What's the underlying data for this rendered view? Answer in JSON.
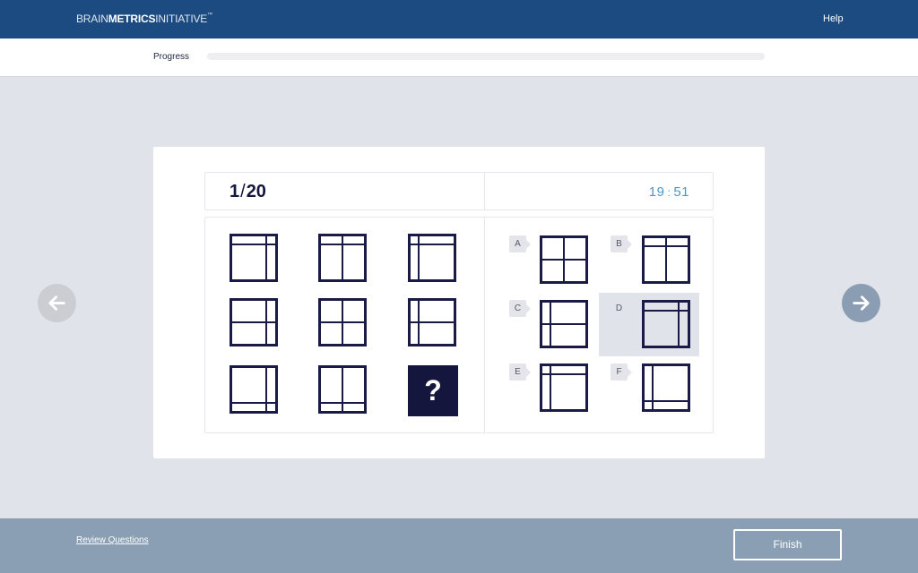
{
  "header": {
    "logo_part1": "BRAIN",
    "logo_part2": "METRICS",
    "logo_part3": "INITIATIVE",
    "logo_tm": "™",
    "help_label": "Help",
    "bar_color": "#1c4b82"
  },
  "progress": {
    "label": "Progress",
    "value_percent": 0
  },
  "question": {
    "current": "1",
    "separator": "/",
    "total": "20"
  },
  "timer": {
    "minutes": "19",
    "separator": ":",
    "seconds": "51"
  },
  "matrix": {
    "missing_symbol": "?",
    "cells": [
      {
        "pattern": "v-right + h-top"
      },
      {
        "pattern": "v-center + h-top"
      },
      {
        "pattern": "v-left + h-top"
      },
      {
        "pattern": "v-right + h-center"
      },
      {
        "pattern": "v-center + h-center"
      },
      {
        "pattern": "v-left + h-center"
      },
      {
        "pattern": "v-right + h-bottom"
      },
      {
        "pattern": "v-center + h-bottom"
      },
      {
        "pattern": "missing"
      }
    ]
  },
  "options": [
    {
      "letter": "A",
      "pattern": "v-center + h-center",
      "selected": false
    },
    {
      "letter": "B",
      "pattern": "v-center + h-top",
      "selected": false
    },
    {
      "letter": "C",
      "pattern": "v-left + h-center",
      "selected": false
    },
    {
      "letter": "D",
      "pattern": "v-right + h-top",
      "selected": true
    },
    {
      "letter": "E",
      "pattern": "v-left + h-top",
      "selected": false
    },
    {
      "letter": "F",
      "pattern": "v-left + h-bottom",
      "selected": false
    }
  ],
  "navigation": {
    "prev_icon": "arrow-left-icon",
    "next_icon": "arrow-right-icon"
  },
  "footer": {
    "review_label": "Review Questions",
    "finish_label": "Finish"
  }
}
